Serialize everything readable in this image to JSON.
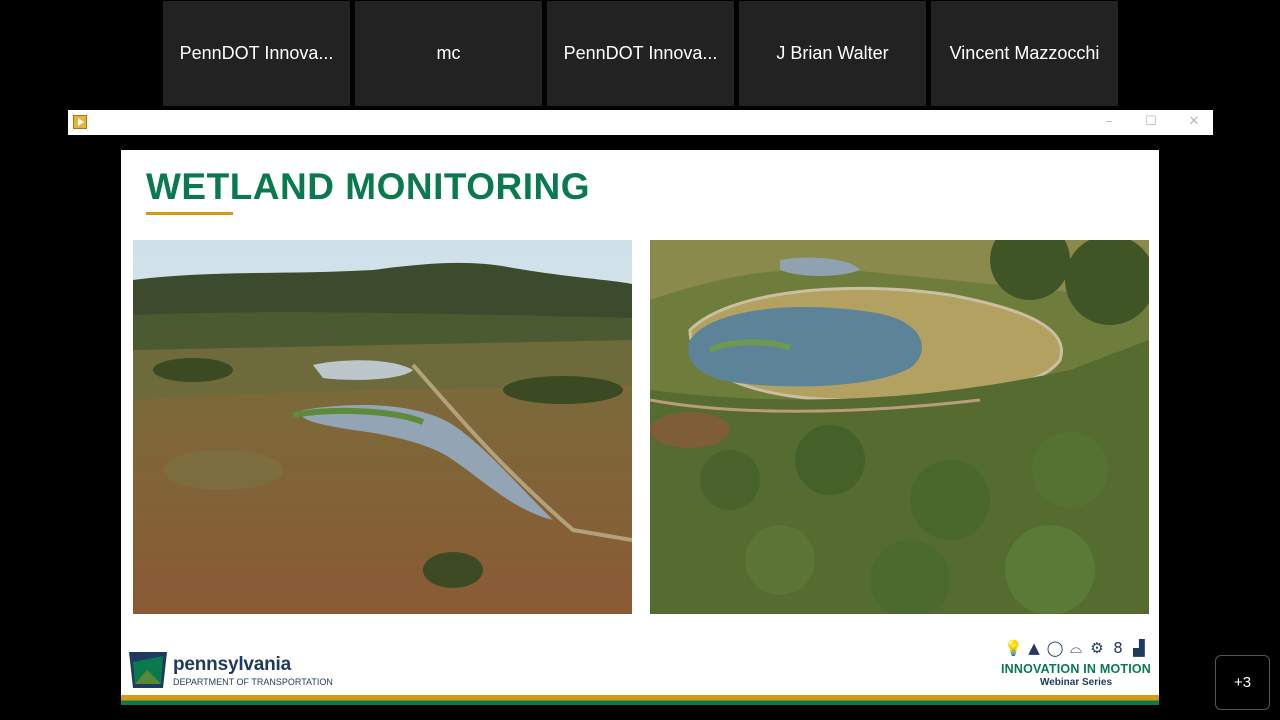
{
  "participants": [
    {
      "name": "PennDOT Innova..."
    },
    {
      "name": "mc"
    },
    {
      "name": "PennDOT Innova..."
    },
    {
      "name": "J Brian Walter"
    },
    {
      "name": "Vincent Mazzocchi"
    }
  ],
  "window": {
    "app_icon": "play-icon",
    "controls": {
      "minimize": "–",
      "maximize": "☐",
      "close": "✕"
    }
  },
  "slide": {
    "title": "WETLAND MONITORING",
    "footer": {
      "brand_name": "pennsylvania",
      "brand_dept": "DEPARTMENT OF TRANSPORTATION",
      "series_title": "INNOVATION IN MOTION",
      "series_subtitle": "Webinar Series"
    }
  },
  "more_participants": "+3",
  "colors": {
    "accent_green": "#0a7a4e",
    "accent_gold": "#d39a13",
    "navy": "#1f3a5f"
  }
}
